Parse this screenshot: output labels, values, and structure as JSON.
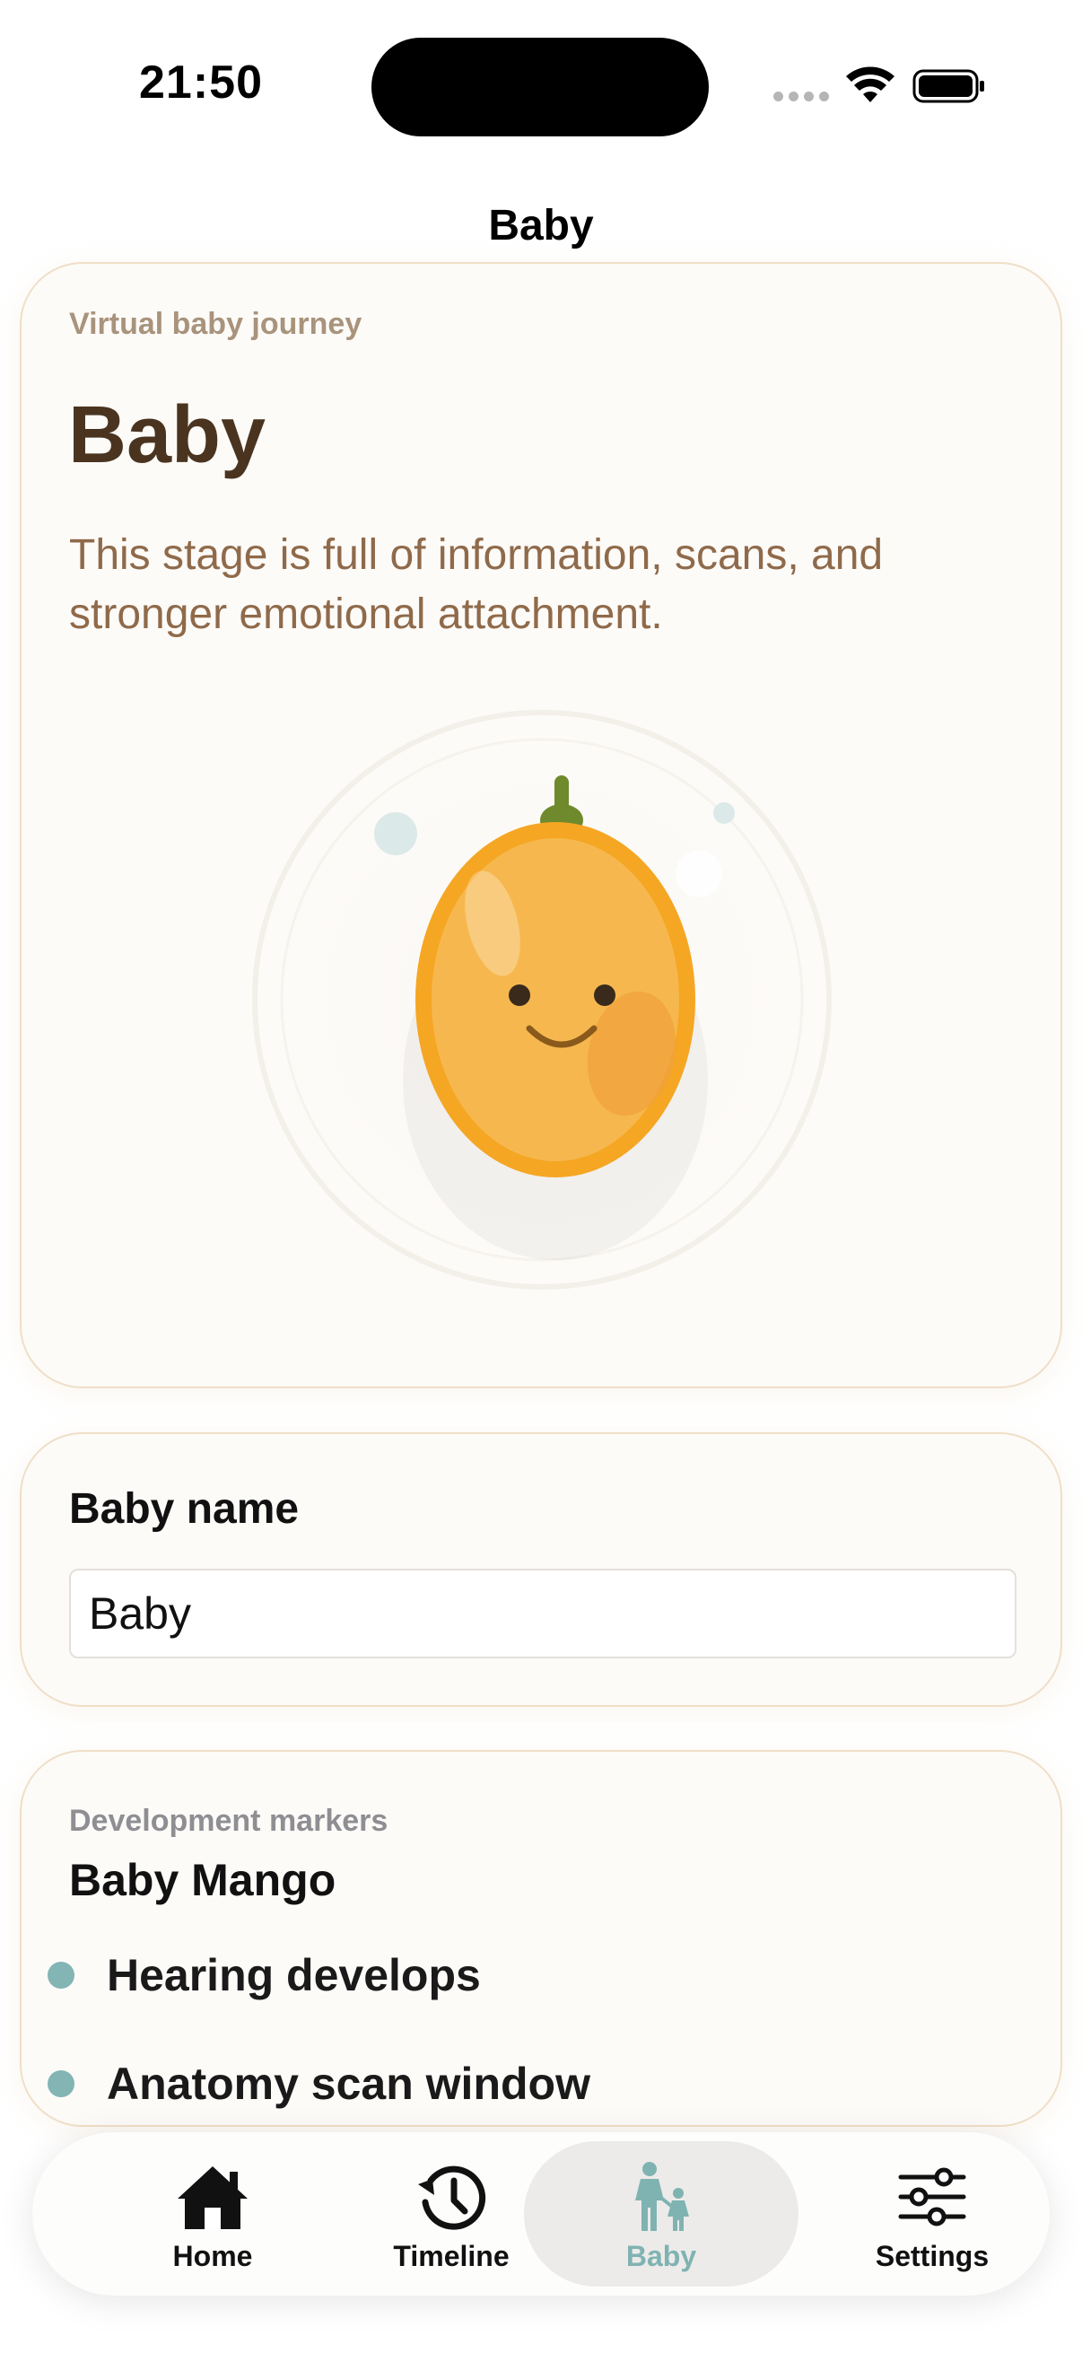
{
  "status_bar": {
    "time": "21:50"
  },
  "nav": {
    "title": "Baby"
  },
  "hero": {
    "eyebrow": "Virtual baby journey",
    "title": "Baby",
    "description": "This stage is full of information, scans, and stronger emotional attachment.",
    "illustration": "mango-character"
  },
  "name_card": {
    "label": "Baby name",
    "value": "Baby"
  },
  "development": {
    "eyebrow": "Development markers",
    "title": "Baby Mango",
    "markers": [
      "Hearing develops",
      "Anatomy scan window"
    ]
  },
  "tabbar": {
    "items": [
      {
        "label": "Home",
        "icon": "home-icon"
      },
      {
        "label": "Timeline",
        "icon": "history-icon"
      },
      {
        "label": "Baby",
        "icon": "parent-child-icon",
        "selected": true
      },
      {
        "label": "Settings",
        "icon": "sliders-icon"
      }
    ]
  },
  "colors": {
    "accent": "#7fb3b2",
    "card_border": "#efdfc8",
    "title_brown": "#4a3420",
    "desc_brown": "#8f6a4a",
    "mango": "#f5a623"
  }
}
